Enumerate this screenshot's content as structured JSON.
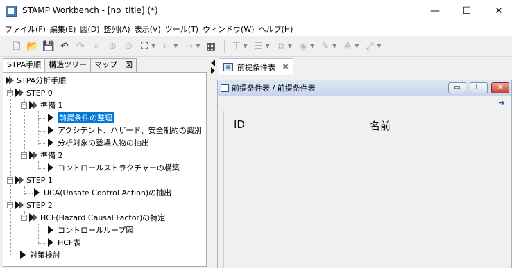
{
  "window": {
    "title": "STAMP Workbench - [no_title] (*)",
    "controls": {
      "minimize": "—",
      "maximize": "☐",
      "close": "✕"
    }
  },
  "menu": [
    "ファイル(F)",
    "編集(E)",
    "図(D)",
    "整列(A)",
    "表示(V)",
    "ツール(T)",
    "ウィンドウ(W)",
    "ヘルプ(H)"
  ],
  "left_panel": {
    "tabs": [
      "STPA手順",
      "構造ツリー",
      "マップ",
      "図"
    ],
    "active_tab": "STPA手順",
    "tree": {
      "root": "STPA分析手順",
      "step0": "STEP 0",
      "prep1": "準備 1",
      "prep1_items": [
        "前提条件の整理",
        "アクシデント、ハザード、安全制約の識別",
        "分析対象の登場人物の抽出"
      ],
      "prep2": "準備 2",
      "prep2_items": [
        "コントロールストラクチャーの構築"
      ],
      "step1": "STEP 1",
      "step1_items": [
        "UCA(Unsafe Control Action)の抽出"
      ],
      "step2": "STEP 2",
      "hcf": "HCF(Hazard Causal Factor)の特定",
      "hcf_items": [
        "コントロールループ図",
        "HCF表"
      ],
      "countermeasure": "対策検討",
      "selected": "前提条件の整理"
    }
  },
  "editor": {
    "tab_label": "前提条件表",
    "tab_icon": "table-icon",
    "inner_title": "前提条件表 / 前提条件表",
    "inner_controls": {
      "minimize": "▭",
      "restore": "❐",
      "close": "✕"
    },
    "columns": [
      "ID",
      "名前"
    ]
  },
  "colors": {
    "selection": "#0078d7",
    "inner_title_gradient_top": "#dfe8f5",
    "inner_close": "#c9432f"
  }
}
